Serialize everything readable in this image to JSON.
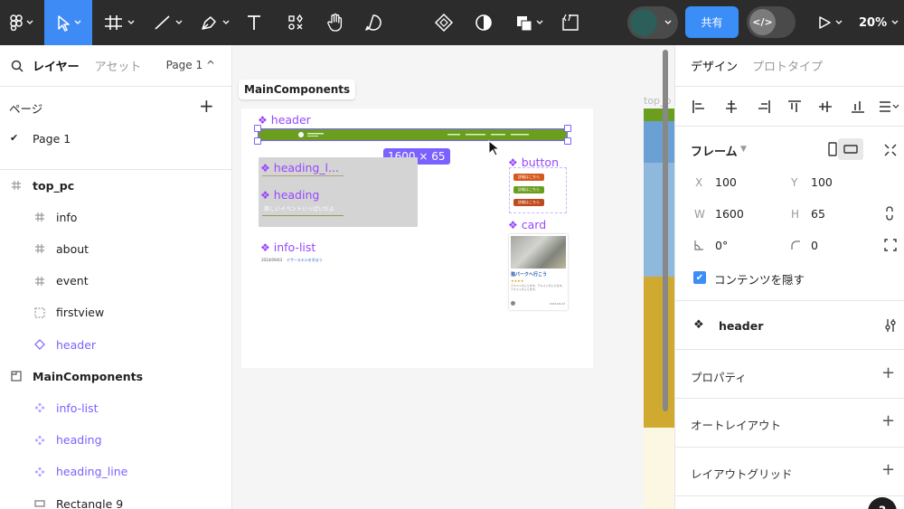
{
  "toolbar": {
    "share_label": "共有",
    "zoom": "20%",
    "dev_mode": "</>",
    "avatar_color": "#2c5e5a",
    "accent": "#3b8df7"
  },
  "left_panel": {
    "tab_layers": "レイヤー",
    "tab_assets": "アセット",
    "page_selector": "Page 1 ^",
    "pages_title": "ページ",
    "add_page": "+",
    "pages": [
      {
        "name": "Page 1",
        "selected": true
      }
    ],
    "layers": [
      {
        "name": "top_pc",
        "icon": "frame-icon",
        "indent": 0,
        "bold": true
      },
      {
        "name": "info",
        "icon": "frame-icon",
        "indent": 1
      },
      {
        "name": "about",
        "icon": "frame-icon",
        "indent": 1
      },
      {
        "name": "event",
        "icon": "frame-icon",
        "indent": 1
      },
      {
        "name": "firstview",
        "icon": "section-dashed-icon",
        "indent": 1
      },
      {
        "name": "header",
        "icon": "instance-icon",
        "indent": 1,
        "purple": true
      },
      {
        "name": "MainComponents",
        "icon": "page-section-icon",
        "indent": 0,
        "bold": true
      },
      {
        "name": "info-list",
        "icon": "component-icon",
        "indent": 1,
        "purple": true
      },
      {
        "name": "heading",
        "icon": "component-icon",
        "indent": 1,
        "purple": true
      },
      {
        "name": "heading_line",
        "icon": "component-icon",
        "indent": 1,
        "purple": true
      },
      {
        "name": "Rectangle 9",
        "icon": "rectangle-icon",
        "indent": 1
      }
    ]
  },
  "canvas": {
    "frame_name": "MainComponents",
    "right_frame_label": "top_p",
    "components": {
      "header": "header",
      "heading_line": "heading_l...",
      "heading": "heading",
      "info_list": "info-list",
      "button": "button",
      "card": "card"
    },
    "size_badge": "1600 × 65",
    "header_color": "#6b9e1f",
    "heading_subtext": "楽しいイベントいっぱいだよ",
    "info_date": "2024/09/03",
    "info_link": "デザースキルを学ぼう",
    "buttons": [
      "詳細はこちら",
      "詳細はこちら",
      "詳細はこちら"
    ],
    "button_colors": [
      "#d45a1f",
      "#6b9e1f",
      "#c14a1a"
    ],
    "card_title": "猫パークへ行こう",
    "card_stars": "★★★★",
    "card_text": "テキストが入ります。テキストが入ります。テキストが入ります。",
    "card_date": "2024.09.03"
  },
  "right_panel": {
    "tab_design": "デザイン",
    "tab_prototype": "プロトタイプ",
    "frame_title": "フレーム",
    "x_label": "X",
    "x": "100",
    "y_label": "Y",
    "y": "100",
    "w_label": "W",
    "w": "1600",
    "h_label": "H",
    "h": "65",
    "rotation": "0°",
    "radius": "0",
    "clip_label": "コンテンツを隠す",
    "clip_checked": true,
    "component_name": "header",
    "sections": [
      "プロパティ",
      "オートレイアウト",
      "レイアウトグリッド"
    ]
  }
}
